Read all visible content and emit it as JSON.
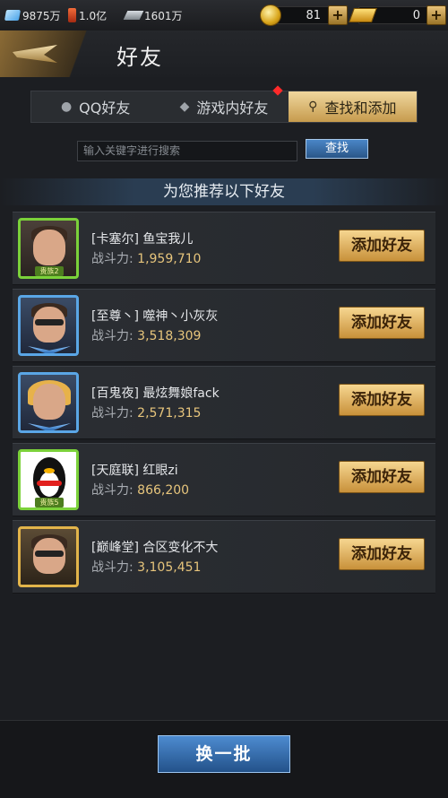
{
  "resources": {
    "diamond": "9875万",
    "fuel": "1.0亿",
    "steel": "1601万",
    "coin": "81",
    "gold": "0"
  },
  "header": {
    "title": "好友"
  },
  "tabs": [
    {
      "label": "QQ好友",
      "icon": "qq-icon"
    },
    {
      "label": "游戏内好友",
      "icon": "friends-icon"
    },
    {
      "label": "查找和添加",
      "icon": "search-icon"
    }
  ],
  "search": {
    "placeholder": "输入关键字进行搜索",
    "button_label": "查找"
  },
  "section_title": "为您推荐以下好友",
  "power_label": "战斗力:",
  "add_label": "添加好友",
  "friends": [
    {
      "name": "[卡塞尔]  鱼宝我儿",
      "power": "1,959,710",
      "badge": "贵族2"
    },
    {
      "name": "[至尊丶]  噬神丶小灰灰",
      "power": "3,518,309",
      "badge": ""
    },
    {
      "name": "[百鬼夜]  最炫舞娘fack",
      "power": "2,571,315",
      "badge": ""
    },
    {
      "name": "[天庭联]  红眼zi",
      "power": "866,200",
      "badge": "贵族5"
    },
    {
      "name": "[巅峰堂]  合区变化不大",
      "power": "3,105,451",
      "badge": ""
    }
  ],
  "footer": {
    "refresh_label": "换一批"
  },
  "colors": {
    "accent_gold": "#e7c57c",
    "button_blue": "#2a5688",
    "tab_active": "#c69b4d"
  }
}
